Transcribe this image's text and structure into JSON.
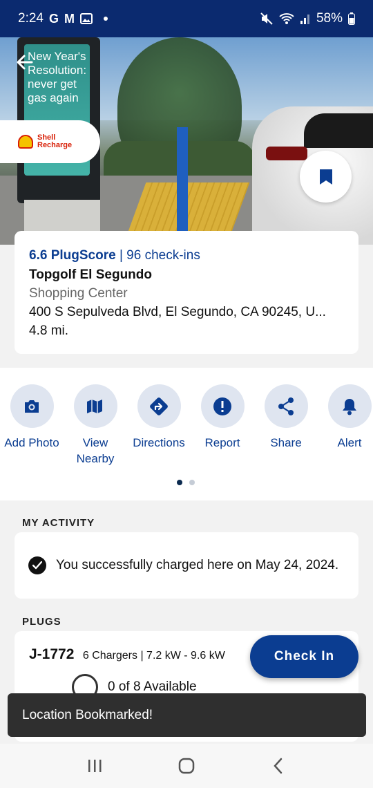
{
  "status_bar": {
    "time": "2:24",
    "app_icons": [
      "G",
      "M"
    ],
    "battery": "58%"
  },
  "hero": {
    "kiosk_text": "New Year's Resolution: never get gas again",
    "brand": {
      "name_line1": "Shell",
      "name_line2": "Recharge"
    }
  },
  "location": {
    "plugscore": "6.6 PlugScore",
    "checkins": " | 96 check-ins",
    "name": "Topgolf El Segundo",
    "type": "Shopping Center",
    "address": "400 S Sepulveda Blvd, El Segundo, CA 90245, U...",
    "distance": "4.8 mi."
  },
  "actions": [
    {
      "label": "Add Photo",
      "icon": "camera-icon"
    },
    {
      "label": "View Nearby",
      "icon": "map-icon"
    },
    {
      "label": "Directions",
      "icon": "directions-icon"
    },
    {
      "label": "Report",
      "icon": "report-icon"
    },
    {
      "label": "Share",
      "icon": "share-icon"
    },
    {
      "label": "Alert",
      "icon": "bell-icon"
    }
  ],
  "activity": {
    "title": "MY ACTIVITY",
    "message": "You successfully charged here on May 24, 2024."
  },
  "plugs": {
    "title": "PLUGS",
    "type": "J-1772",
    "meta": "6 Chargers | 7.2 kW - 9.6 kW",
    "availability": "0 of 8 Available"
  },
  "checkin_label": "Check In",
  "toast": "Location Bookmarked!",
  "colors": {
    "brand_blue": "#0b3d91",
    "status_bar": "#0b2a6f"
  }
}
